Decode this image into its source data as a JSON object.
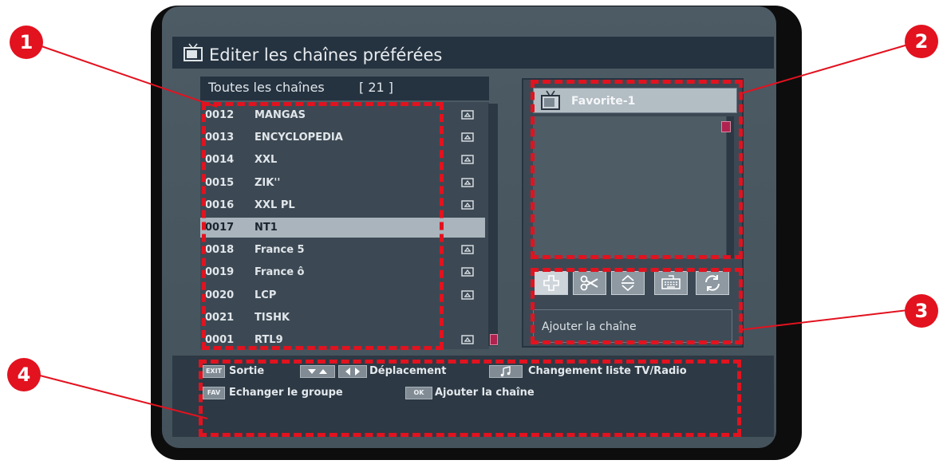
{
  "screen": {
    "title": "Editer les chaînes préférées",
    "title_icon": "tv-icon"
  },
  "channel_list": {
    "header_label": "Toutes les chaînes",
    "count": "[ 21 ]",
    "selected_index": 5,
    "channels": [
      {
        "number": "0012",
        "name": "MANGAS",
        "locked": true
      },
      {
        "number": "0013",
        "name": "ENCYCLOPEDIA",
        "locked": true
      },
      {
        "number": "0014",
        "name": "XXL",
        "locked": true
      },
      {
        "number": "0015",
        "name": "ZIK''",
        "locked": true
      },
      {
        "number": "0016",
        "name": "XXL PL",
        "locked": true
      },
      {
        "number": "0017",
        "name": "NT1",
        "locked": false
      },
      {
        "number": "0018",
        "name": "France 5",
        "locked": true
      },
      {
        "number": "0019",
        "name": "France ô",
        "locked": true
      },
      {
        "number": "0020",
        "name": "LCP",
        "locked": true
      },
      {
        "number": "0021",
        "name": "TISHK",
        "locked": false
      },
      {
        "number": "0001",
        "name": "RTL9",
        "locked": true
      }
    ]
  },
  "favorite_panel": {
    "group_name": "Favorite-1",
    "group_icon": "tv-icon",
    "tools": [
      {
        "name": "add-icon",
        "active": true
      },
      {
        "name": "scissors-icon",
        "active": false
      },
      {
        "name": "move-icon",
        "active": false
      },
      {
        "name": "keyboard-icon",
        "active": false
      },
      {
        "name": "refresh-icon",
        "active": false
      }
    ],
    "action_hint": "Ajouter la chaîne"
  },
  "help": {
    "exit_key": "EXIT",
    "exit_label": "Sortie",
    "move_label": "Déplacement",
    "switch_label": "Changement liste TV/Radio",
    "fav_key": "FAV",
    "fav_label": "Echanger le groupe",
    "ok_key": "OK",
    "ok_label": "Ajouter la chaîne"
  },
  "callouts": [
    "1",
    "2",
    "3",
    "4"
  ],
  "colors": {
    "callout_red": "#e2121f",
    "selection": "#a9b4bc",
    "scroll_thumb": "#b02250"
  }
}
